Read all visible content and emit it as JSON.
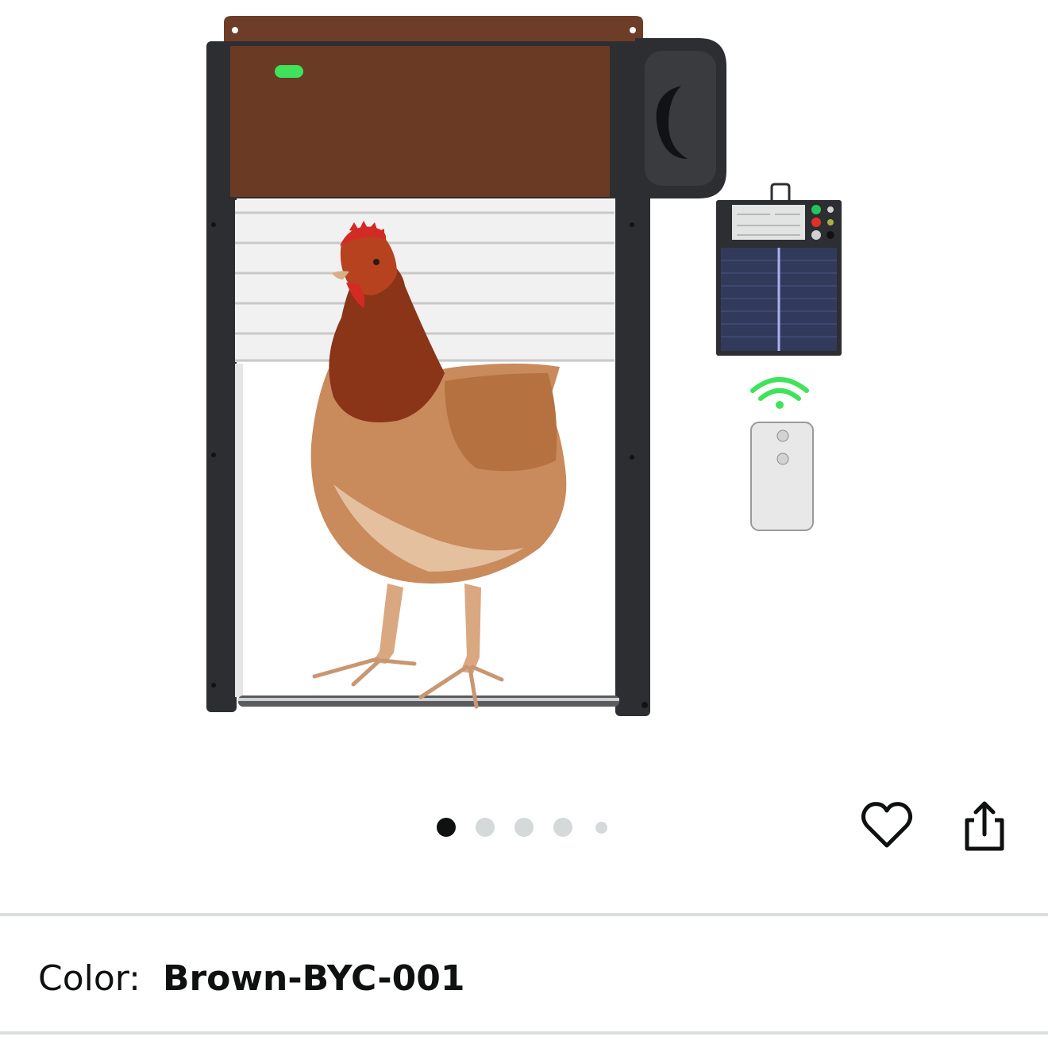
{
  "product_image": {
    "icon": "chicken-coop-door-product-photo",
    "colors": {
      "frame": "#2b2c2e",
      "top_panel": "#6b3a26",
      "led": "#3ee35a",
      "slats": "#eeeeee"
    }
  },
  "carousel": {
    "total": 5,
    "active_index": 0,
    "active_color": "#0f1111",
    "inactive_color": "#d5d9d9"
  },
  "actions": {
    "favorite_icon": "heart-icon",
    "share_icon": "share-icon"
  },
  "variant": {
    "label": "Color:",
    "value": "Brown-BYC-001"
  }
}
